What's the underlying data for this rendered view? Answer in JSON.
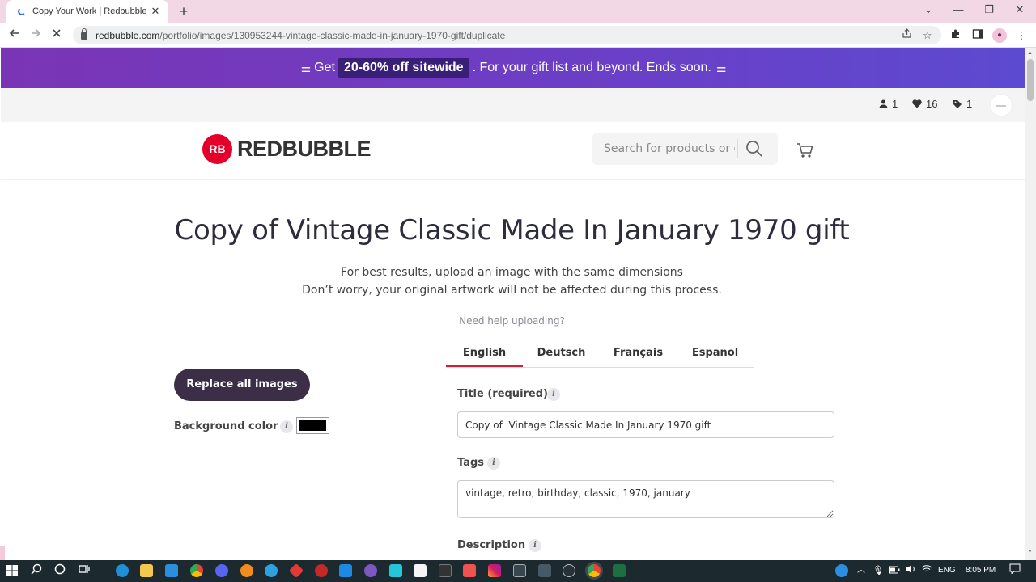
{
  "browser": {
    "tab_title": "Copy Your Work | Redbubble",
    "tab_close": "✕",
    "new_tab": "+",
    "url_host": "redbubble.com",
    "url_path": "/portfolio/images/130953244-vintage-classic-made-in-january-1970-gift/duplicate",
    "controls": {
      "minimize": "—",
      "maximize": "❐",
      "close": "✕",
      "dropdown": "⌄"
    }
  },
  "promo": {
    "prefix": "Get",
    "highlight": "20-60% off sitewide",
    "suffix": ". For your gift list and beyond. Ends soon."
  },
  "utility": {
    "following_count": "1",
    "favorites_count": "16",
    "tags_count": "1"
  },
  "header": {
    "logo_mark": "RB",
    "logo_text": "REDBUBBLE",
    "search_placeholder": "Search for products or designs"
  },
  "main": {
    "title": "Copy of Vintage Classic Made In January 1970 gift",
    "subtext_1": "For best results, upload an image with the same dimensions",
    "subtext_2": "Don’t worry, your original artwork will not be affected during this process.",
    "help_link": "Need help uploading?",
    "languages": [
      "English",
      "Deutsch",
      "Français",
      "Español"
    ],
    "replace_button": "Replace all images",
    "background_label": "Background color",
    "background_color": "#000000",
    "title_label": "Title (required)",
    "title_value": "Copy of  Vintage Classic Made In January 1970 gift",
    "tags_label": "Tags",
    "tags_value": "vintage, retro, birthday, classic, 1970, january",
    "description_label": "Description",
    "info_glyph": "i"
  },
  "taskbar": {
    "language": "ENG",
    "time": "8:05 PM"
  },
  "colors": {
    "promo_bg": "#6b3fc7",
    "brand_red": "#e4002b",
    "button_dark": "#3c2e46",
    "active_tab": "#c7243a"
  }
}
